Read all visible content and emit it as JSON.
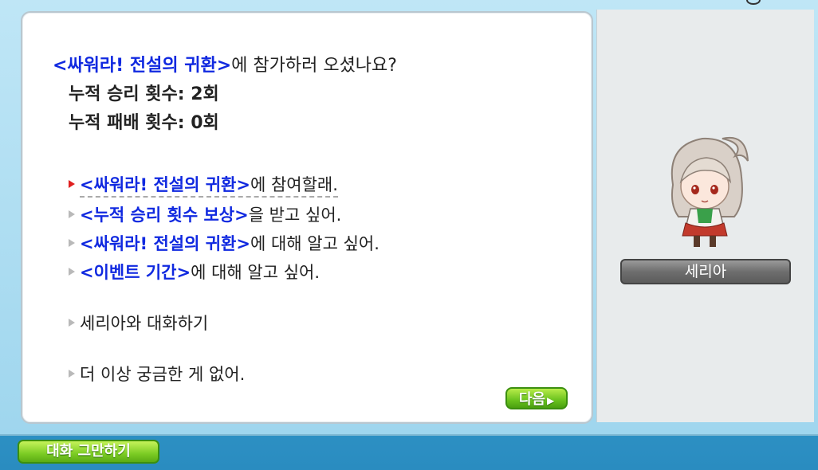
{
  "dialog": {
    "intro_title": "<싸워라! 전설의 귀환>",
    "intro_rest": "에 참가하러 오셨나요?",
    "wins": "누적 승리 횟수: 2회",
    "losses": "누적 패배 횟수: 0회",
    "options": [
      {
        "title": "<싸워라! 전설의 귀환>",
        "rest": "에 참여할래."
      },
      {
        "title": "<누적 승리 횟수 보상>",
        "rest": "을 받고 싶어."
      },
      {
        "title": "<싸워라! 전설의 귀환>",
        "rest": "에 대해 알고 싶어."
      },
      {
        "title": "<이벤트 기간>",
        "rest": "에 대해 알고 싶어."
      }
    ],
    "talk_option": "세리아와 대화하기",
    "exit_option": "더 이상 궁금한 게 없어.",
    "next_label": "다음"
  },
  "npc": {
    "name": "세리아"
  },
  "footer": {
    "end_label": "대화 그만하기"
  },
  "colors": {
    "title_blue": "#1029e0",
    "button_green": "#6ac21e",
    "nameplate_gray": "#6e6e6e"
  }
}
